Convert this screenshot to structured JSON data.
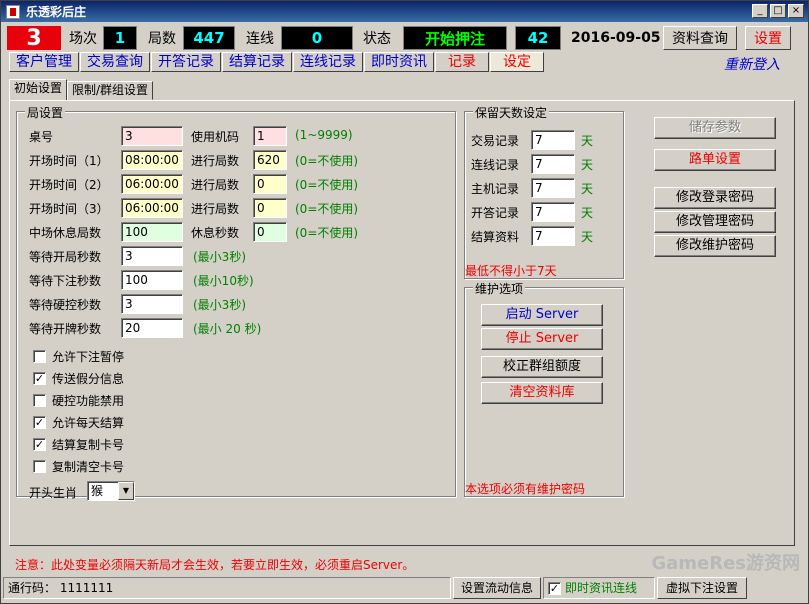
{
  "window": {
    "title": "乐透彩后庄",
    "btn_min": "_",
    "btn_max": "□",
    "btn_close": "×"
  },
  "status": {
    "table_no": "3",
    "round_label": "场次",
    "round_value": "1",
    "count_label": "局数",
    "count_value": "447",
    "streak_label": "连线",
    "streak_value": "0",
    "state_label": "状态",
    "state_value": "开始押注",
    "timer_value": "42",
    "date": "2016-09-05",
    "query_button": "资料查询",
    "settings_button": "设置"
  },
  "menu": {
    "items": [
      "客户管理",
      "交易查询",
      "开答记录",
      "结算记录",
      "连线记录",
      "即时资讯",
      "记录",
      "设定"
    ],
    "relogin": "重新登入"
  },
  "tabs": [
    "初始设置",
    "限制/群组设置"
  ],
  "game_settings": {
    "title": "局设置",
    "table_label": "桌号",
    "table_value": "3",
    "machine_label": "使用机码",
    "machine_value": "1",
    "machine_hint": "(1~9999)",
    "open1_label": "开场时间（1）",
    "open1_value": "08:00:00",
    "rounds1_label": "进行局数",
    "rounds1_value": "620",
    "rounds1_hint": "(0=不使用)",
    "open2_label": "开场时间（2）",
    "open2_value": "06:00:00",
    "rounds2_label": "进行局数",
    "rounds2_value": "0",
    "rounds2_hint": "(0=不使用)",
    "open3_label": "开场时间（3）",
    "open3_value": "06:00:00",
    "rounds3_label": "进行局数",
    "rounds3_value": "0",
    "rounds3_hint": "(0=不使用)",
    "break_label": "中场休息局数",
    "break_value": "100",
    "rest_label": "休息秒数",
    "rest_value": "0",
    "rest_hint": "(0=不使用)",
    "wait_open_label": "等待开局秒数",
    "wait_open_value": "3",
    "wait_open_hint": "(最小3秒)",
    "wait_bet_label": "等待下注秒数",
    "wait_bet_value": "100",
    "wait_bet_hint": "(最小10秒)",
    "wait_hard_label": "等待硬控秒数",
    "wait_hard_value": "3",
    "wait_hard_hint": "(最小3秒)",
    "wait_card_label": "等待开牌秒数",
    "wait_card_value": "20",
    "wait_card_hint": "(最小 20 秒)",
    "checkboxes": [
      {
        "label": "允许下注暂停",
        "mark": ""
      },
      {
        "label": "传送假分信息",
        "mark": "✓"
      },
      {
        "label": "硬控功能禁用",
        "mark": ""
      },
      {
        "label": "允许每天结算",
        "mark": "✓"
      },
      {
        "label": "结算复制卡号",
        "mark": "✓"
      },
      {
        "label": "复制清空卡号",
        "mark": ""
      }
    ],
    "zodiac_label": "开头生肖",
    "zodiac_value": "猴"
  },
  "retention": {
    "title": "保留天数设定",
    "rows": [
      {
        "label": "交易记录",
        "value": "7",
        "unit": "天"
      },
      {
        "label": "连线记录",
        "value": "7",
        "unit": "天"
      },
      {
        "label": "主机记录",
        "value": "7",
        "unit": "天"
      },
      {
        "label": "开答记录",
        "value": "7",
        "unit": "天"
      },
      {
        "label": "结算资料",
        "value": "7",
        "unit": "天"
      }
    ],
    "min_note": "最低不得小于7天"
  },
  "maintenance": {
    "title": "维护选项",
    "start_server": "启动 Server",
    "stop_server": "停止 Server",
    "calibrate": "校正群组额度",
    "clear_db": "清空资料库",
    "note": "本选项必须有维护密码"
  },
  "actions": {
    "save_params": "储存参数",
    "route_settings": "路单设置",
    "change_login_pw": "修改登录密码",
    "change_admin_pw": "修改管理密码",
    "change_maint_pw": "修改维护密码"
  },
  "footer_note": "注意：此处变量必须隔天新局才会生效，若要立即生效，必须重启Server。",
  "watermark": "GameRes游资网",
  "statusbar": {
    "pass_code": "通行码： 1111111",
    "flow_info": "设置流动信息",
    "live_link_label": "即时资讯连线",
    "live_link_mark": "✓",
    "virtual_bet": "虚拟下注设置"
  },
  "colors": {
    "accent_red": "#e8000b",
    "link_blue": "#0000cc",
    "hint_green": "#008000",
    "status_black": "#000000"
  }
}
